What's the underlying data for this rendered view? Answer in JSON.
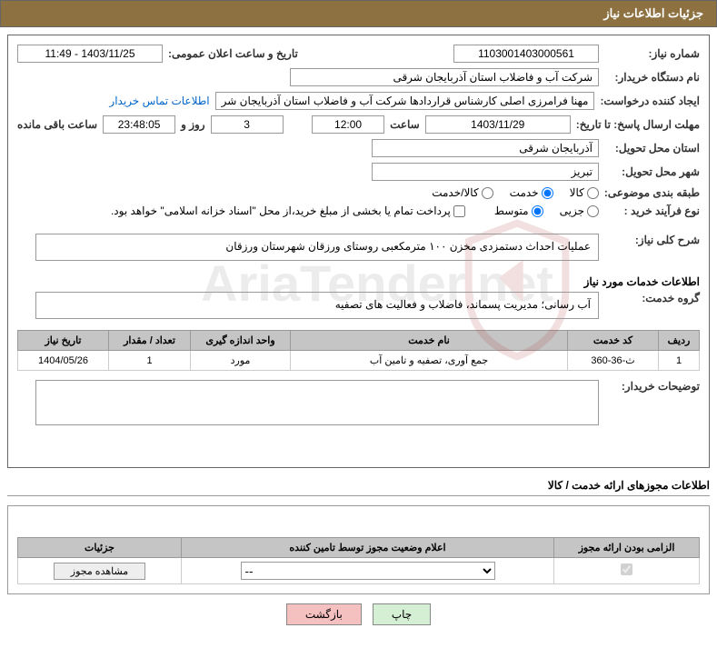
{
  "pageTitle": "جزئیات اطلاعات نیاز",
  "labels": {
    "needNumber": "شماره نیاز:",
    "announceDateTime": "تاریخ و ساعت اعلان عمومی:",
    "buyerOrg": "نام دستگاه خریدار:",
    "requester": "ایجاد کننده درخواست:",
    "contactLink": "اطلاعات تماس خریدار",
    "deadline": "مهلت ارسال پاسخ: تا تاریخ:",
    "hour": "ساعت",
    "daysAnd": "روز و",
    "remaining": "ساعت باقی مانده",
    "deliverProvince": "استان محل تحویل:",
    "deliverCity": "شهر محل تحویل:",
    "category": "طبقه بندی موضوعی:",
    "cat_goods": "کالا",
    "cat_service": "خدمت",
    "cat_goodsService": "کالا/خدمت",
    "purchaseType": "نوع فرآیند خرید :",
    "pt_partial": "جزیی",
    "pt_medium": "متوسط",
    "paymentNote": "پرداخت تمام یا بخشی از مبلغ خرید،از محل \"اسناد خزانه اسلامی\" خواهد بود.",
    "needDesc": "شرح کلی نیاز:",
    "servicesInfo": "اطلاعات خدمات مورد نیاز",
    "serviceGroup": "گروه خدمت:",
    "buyerNotes": "توضیحات خریدار:"
  },
  "values": {
    "needNumber": "1103001403000561",
    "announceDateTime": "1403/11/25 - 11:49",
    "buyerOrg": "شرکت آب و فاضلاب استان آذربایجان شرقی",
    "requester": "مهنا فرامرزی اصلی کارشناس قراردادها شرکت آب و فاضلاب استان آذربایجان شر",
    "deadlineDate": "1403/11/29",
    "deadlineHour": "12:00",
    "daysLeft": "3",
    "hoursLeft": "23:48:05",
    "province": "آذربایجان شرقی",
    "city": "تبریز",
    "needDesc": "عملیات احداث دستمزدی مخزن ۱۰۰ مترمکعبی روستای ورزقان شهرستان ورزقان",
    "serviceGroup": "آب رسانی؛ مدیریت پسماند، فاضلاب و فعالیت های تصفیه"
  },
  "serviceTable": {
    "headers": {
      "row": "ردیف",
      "code": "کد خدمت",
      "name": "نام خدمت",
      "unit": "واحد اندازه گیری",
      "qty": "تعداد / مقدار",
      "date": "تاریخ نیاز"
    },
    "rows": [
      {
        "row": "1",
        "code": "ث-36-360",
        "name": "جمع آوری، تصفیه و تامین آب",
        "unit": "مورد",
        "qty": "1",
        "date": "1404/05/26"
      }
    ]
  },
  "licenseSection": {
    "title": "اطلاعات مجوزهای ارائه خدمت / کالا",
    "headers": {
      "mandatory": "الزامی بودن ارائه مجوز",
      "status": "اعلام وضعیت مجوز توسط تامین کننده",
      "details": "جزئیات"
    },
    "selectPlaceholder": "--",
    "viewBtn": "مشاهده مجوز"
  },
  "actions": {
    "print": "چاپ",
    "back": "بازگشت"
  },
  "watermark": "AriaTender.net"
}
